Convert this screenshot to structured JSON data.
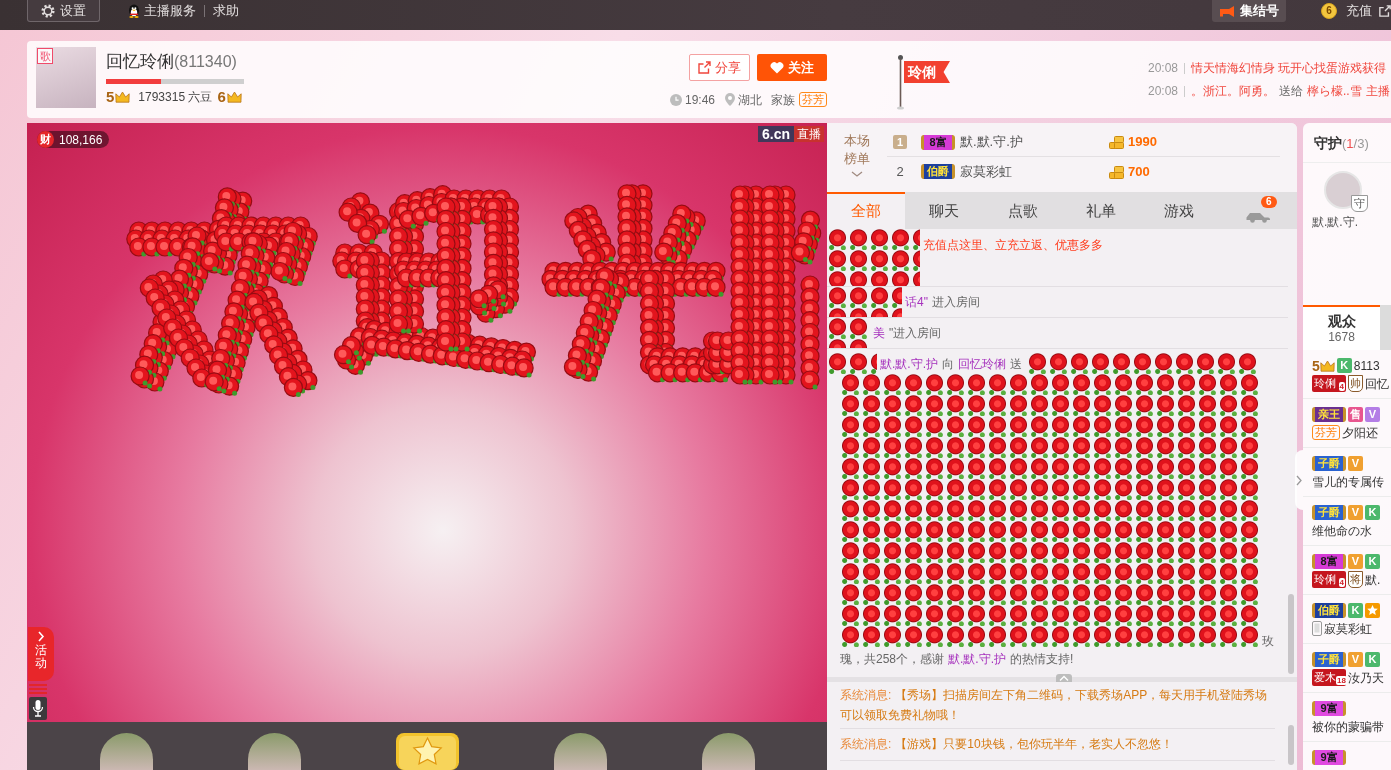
{
  "top_bar": {
    "settings": "设置",
    "links": [
      "主播服务",
      "求助"
    ],
    "rally": "集结号",
    "coin": "6",
    "recharge": "充值"
  },
  "streamer": {
    "tag": "歌",
    "name": "回忆玲俐",
    "room_id": "(811340)",
    "level": 0.4,
    "host_level": "5",
    "beans": "1793315 六豆",
    "rich_level": "6",
    "share": "分享",
    "follow": "关注",
    "time": "19:46",
    "location": "湖北",
    "family_label": "家族",
    "family": "芬芳"
  },
  "flag": {
    "label": "玲俐"
  },
  "broadcasts": [
    {
      "time": "20:08",
      "parts": [
        {
          "kind": "red",
          "text": "情天情海幻情身 玩开心找蛋游戏获得"
        }
      ]
    },
    {
      "time": "20:08",
      "parts": [
        {
          "kind": "red",
          "text": "。浙江。阿勇。"
        },
        {
          "kind": "plain",
          "text": "送给"
        },
        {
          "kind": "red",
          "text": "檸ら檬..雪"
        },
        {
          "kind": "red",
          "text": "主播"
        }
      ]
    }
  ],
  "video": {
    "wealth_tag": "财",
    "wealth": "108,166",
    "logo": "6.cn",
    "live": "直播",
    "activity": "活动",
    "strip": [
      {
        "kind": "avatar"
      },
      {
        "kind": "avatar"
      },
      {
        "kind": "gift"
      },
      {
        "kind": "avatar"
      },
      {
        "kind": "avatar"
      }
    ]
  },
  "ranking": {
    "label": "本场榜单",
    "rows": [
      {
        "rank": "1",
        "kind": "medal",
        "title": "8富",
        "color": "#d63ad6",
        "name": "默.默.守.护",
        "amount": "1990"
      },
      {
        "rank": "2",
        "kind": "plain",
        "title": "伯爵",
        "color": "#1c3f9e",
        "name": "寂莫彩虹",
        "amount": "700"
      }
    ]
  },
  "tabs": [
    {
      "kind": "text",
      "label": "全部",
      "selected": true
    },
    {
      "kind": "text",
      "label": "聊天",
      "selected": false
    },
    {
      "kind": "text",
      "label": "点歌",
      "selected": false
    },
    {
      "kind": "text",
      "label": "礼单",
      "selected": false
    },
    {
      "kind": "text",
      "label": "游戏",
      "selected": false
    },
    {
      "kind": "car",
      "badge": "6",
      "selected": false
    }
  ],
  "chat": [
    {
      "kind": "notice",
      "parts": [
        {
          "kind": "alert",
          "text": "充值点这里、立充立返、优惠多多"
        }
      ]
    },
    {
      "kind": "entry",
      "parts": [
        {
          "kind": "user",
          "text": "话4\""
        },
        {
          "kind": "plain",
          "text": "进入房间"
        }
      ]
    },
    {
      "kind": "entry",
      "parts": [
        {
          "kind": "user",
          "text": "美"
        },
        {
          "kind": "plain",
          "text": "\"进入房间"
        }
      ]
    },
    {
      "kind": "gift",
      "sender": "默.默.守.护",
      "to": "向",
      "receiver": "回忆玲俐",
      "verb": "送",
      "unit_start": "玫",
      "tail": "瑰，共258个，感谢",
      "thanked": "默.默.守.护",
      "end": "的热情支持!"
    }
  ],
  "system_messages": [
    {
      "label": "系统消息:",
      "text": "【秀场】扫描房间左下角二维码，下载秀场APP，每天用手机登陆秀场可以领取免费礼物哦！"
    },
    {
      "label": "系统消息:",
      "text": "【游戏】只要10块钱，包你玩半年，老实人不忽悠！"
    }
  ],
  "guard": {
    "title": "守护",
    "count": [
      {
        "kind": "plain",
        "text": "("
      },
      {
        "kind": "hot",
        "text": "1"
      },
      {
        "kind": "plain",
        "text": "/3)"
      }
    ],
    "members": [
      {
        "name": "默.默.守.",
        "badge": "守"
      }
    ]
  },
  "audience": {
    "tabs": [
      {
        "label": "观众",
        "count": "1678",
        "selected": true
      },
      {
        "selected": false
      }
    ],
    "rows": [
      {
        "top": [
          {
            "kind": "level",
            "text": "5"
          },
          {
            "kind": "tag",
            "text": "K",
            "color": "#4cb86c"
          },
          {
            "kind": "text",
            "text": "8113"
          }
        ],
        "bottom": [
          {
            "kind": "fan",
            "text": "玲俐",
            "sub": "4"
          },
          {
            "kind": "medal",
            "text": "帅"
          },
          {
            "kind": "text",
            "text": "回忆"
          }
        ]
      },
      {
        "top": [
          {
            "kind": "rank",
            "text": "亲王",
            "color": "#6b2f8f"
          },
          {
            "kind": "tag",
            "text": "售",
            "color": "#e8558f"
          },
          {
            "kind": "tag",
            "text": "V",
            "color": "#b47ee6"
          }
        ],
        "bottom": [
          {
            "kind": "family",
            "text": "芬芳"
          },
          {
            "kind": "text",
            "text": "夕阳还"
          }
        ]
      },
      {
        "top": [
          {
            "kind": "rank",
            "text": "子爵",
            "color": "#2a62d0"
          },
          {
            "kind": "tag",
            "text": "V",
            "color": "#f0a030"
          }
        ],
        "bottom": [
          {
            "kind": "text",
            "text": "雪儿的专属传"
          }
        ]
      },
      {
        "top": [
          {
            "kind": "rank",
            "text": "子爵",
            "color": "#2a62d0"
          },
          {
            "kind": "tag",
            "text": "V",
            "color": "#f0a030"
          },
          {
            "kind": "tag",
            "text": "K",
            "color": "#4cb86c"
          }
        ],
        "bottom": [
          {
            "kind": "text",
            "text": "维他命の水"
          }
        ]
      },
      {
        "top": [
          {
            "kind": "rank",
            "text": "8富",
            "color": "#d63ad6"
          },
          {
            "kind": "tag",
            "text": "V",
            "color": "#f0a030"
          },
          {
            "kind": "tag",
            "text": "K",
            "color": "#4cb86c"
          }
        ],
        "bottom": [
          {
            "kind": "fan",
            "text": "玲俐",
            "sub": "4"
          },
          {
            "kind": "medal",
            "text": "将"
          },
          {
            "kind": "text",
            "text": "默."
          }
        ]
      },
      {
        "top": [
          {
            "kind": "rank",
            "text": "伯爵",
            "color": "#1c3f9e"
          },
          {
            "kind": "tag",
            "text": "K",
            "color": "#4cb86c"
          },
          {
            "kind": "star"
          }
        ],
        "bottom": [
          {
            "kind": "phone"
          },
          {
            "kind": "text",
            "text": "寂莫彩虹"
          }
        ]
      },
      {
        "top": [
          {
            "kind": "rank",
            "text": "子爵",
            "color": "#2a62d0"
          },
          {
            "kind": "tag",
            "text": "V",
            "color": "#f0a030"
          },
          {
            "kind": "tag",
            "text": "K",
            "color": "#4cb86c"
          }
        ],
        "bottom": [
          {
            "kind": "fan",
            "text": "爱木",
            "sub": "18"
          },
          {
            "kind": "text",
            "text": "汝乃天"
          }
        ]
      },
      {
        "top": [
          {
            "kind": "rank",
            "text": "9富",
            "color": "#e04ae0"
          }
        ],
        "bottom": [
          {
            "kind": "text",
            "text": "被你的蒙骗带"
          }
        ]
      },
      {
        "top": [
          {
            "kind": "rank",
            "text": "9富",
            "color": "#e04ae0"
          }
        ]
      }
    ]
  }
}
